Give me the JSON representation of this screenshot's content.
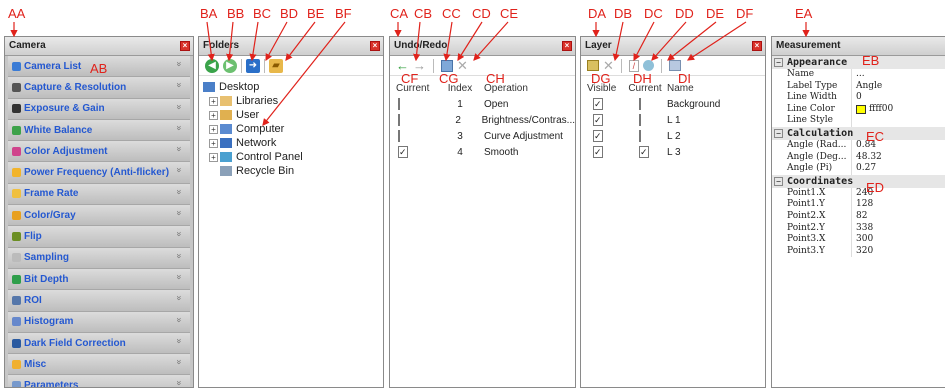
{
  "camera": {
    "title": "Camera",
    "items": [
      {
        "label": "Camera List",
        "icon": "camera-icon",
        "color": "#3a7bd5"
      },
      {
        "label": "Capture & Resolution",
        "icon": "capture-icon",
        "color": "#555555"
      },
      {
        "label": "Exposure & Gain",
        "icon": "exposure-icon",
        "color": "#333333"
      },
      {
        "label": "White Balance",
        "icon": "white-balance-icon",
        "color": "#3da24a"
      },
      {
        "label": "Color Adjustment",
        "icon": "color-wheel-icon",
        "color": "#d0448c"
      },
      {
        "label": "Power Frequency (Anti-flicker)",
        "icon": "power-frequency-icon",
        "color": "#f2b42b"
      },
      {
        "label": "Frame Rate",
        "icon": "frame-rate-icon",
        "color": "#f0c040"
      },
      {
        "label": "Color/Gray",
        "icon": "color-gray-icon",
        "color": "#e8a020"
      },
      {
        "label": "Flip",
        "icon": "flip-icon",
        "color": "#6b8e23"
      },
      {
        "label": "Sampling",
        "icon": "sampling-icon",
        "color": "#bbbbbb"
      },
      {
        "label": "Bit Depth",
        "icon": "bit-depth-icon",
        "color": "#2e9e4a"
      },
      {
        "label": "ROI",
        "icon": "roi-icon",
        "color": "#5577aa"
      },
      {
        "label": "Histogram",
        "icon": "histogram-icon",
        "color": "#6688cc"
      },
      {
        "label": "Dark Field Correction",
        "icon": "dark-field-icon",
        "color": "#2a5aa0"
      },
      {
        "label": "Misc",
        "icon": "misc-icon",
        "color": "#f0b030"
      },
      {
        "label": "Parameters",
        "icon": "parameters-icon",
        "color": "#7799cc"
      }
    ]
  },
  "folders": {
    "title": "Folders",
    "tree": [
      {
        "label": "Desktop",
        "level": 0,
        "expander": "",
        "icon": "desktop-icon"
      },
      {
        "label": "Libraries",
        "level": 1,
        "expander": "+",
        "icon": "libraries-icon"
      },
      {
        "label": "User",
        "level": 1,
        "expander": "+",
        "icon": "user-folder-icon"
      },
      {
        "label": "Computer",
        "level": 1,
        "expander": "+",
        "icon": "computer-icon"
      },
      {
        "label": "Network",
        "level": 1,
        "expander": "+",
        "icon": "network-icon"
      },
      {
        "label": "Control Panel",
        "level": 1,
        "expander": "+",
        "icon": "control-panel-icon"
      },
      {
        "label": "Recycle Bin",
        "level": 1,
        "expander": "",
        "icon": "recycle-bin-icon"
      }
    ]
  },
  "undo": {
    "title": "Undo/Redo",
    "columns": [
      "Current",
      "Index",
      "Operation"
    ],
    "rows": [
      {
        "current": false,
        "index": "1",
        "operation": "Open"
      },
      {
        "current": false,
        "index": "2",
        "operation": "Brightness/Contras..."
      },
      {
        "current": false,
        "index": "3",
        "operation": "Curve Adjustment"
      },
      {
        "current": true,
        "index": "4",
        "operation": "Smooth"
      }
    ]
  },
  "layer": {
    "title": "Layer",
    "columns": [
      "Visible",
      "Current",
      "Name"
    ],
    "rows": [
      {
        "visible": true,
        "current": false,
        "name": "Background"
      },
      {
        "visible": true,
        "current": false,
        "name": "L 1"
      },
      {
        "visible": true,
        "current": false,
        "name": "L 2"
      },
      {
        "visible": true,
        "current": true,
        "name": "L 3"
      }
    ]
  },
  "measurement": {
    "title": "Measurement",
    "sections": [
      {
        "name": "Appearance",
        "rows": [
          {
            "key": "Name",
            "value": "..."
          },
          {
            "key": "Label Type",
            "value": "Angle"
          },
          {
            "key": "Line Width",
            "value": "0"
          },
          {
            "key": "Line Color",
            "value": "ffff00",
            "swatch": "#ffff00"
          },
          {
            "key": "Line Style",
            "value": ""
          }
        ]
      },
      {
        "name": "Calculation",
        "rows": [
          {
            "key": "Angle (Rad...",
            "value": "0.84"
          },
          {
            "key": "Angle (Deg...",
            "value": "48.32"
          },
          {
            "key": "Angle (Pi)",
            "value": "0.27"
          }
        ]
      },
      {
        "name": "Coordinates",
        "rows": [
          {
            "key": "Point1.X",
            "value": "240"
          },
          {
            "key": "Point1.Y",
            "value": "128"
          },
          {
            "key": "Point2.X",
            "value": "82"
          },
          {
            "key": "Point2.Y",
            "value": "338"
          },
          {
            "key": "Point3.X",
            "value": "300"
          },
          {
            "key": "Point3.Y",
            "value": "320"
          }
        ]
      }
    ]
  },
  "annotations": {
    "AA": "AA",
    "AB": "AB",
    "BA": "BA",
    "BB": "BB",
    "BC": "BC",
    "BD": "BD",
    "BE": "BE",
    "BF": "BF",
    "CA": "CA",
    "CB": "CB",
    "CC": "CC",
    "CD": "CD",
    "CE": "CE",
    "CF": "CF",
    "CG": "CG",
    "CH": "CH",
    "DA": "DA",
    "DB": "DB",
    "DC": "DC",
    "DD": "DD",
    "DE": "DE",
    "DF": "DF",
    "DG": "DG",
    "DH": "DH",
    "DI": "DI",
    "EA": "EA",
    "EB": "EB",
    "EC": "EC",
    "ED": "ED"
  },
  "colors": {
    "annotation": "#e0221b",
    "close": "#d9322a",
    "accent": "#2458d0"
  }
}
